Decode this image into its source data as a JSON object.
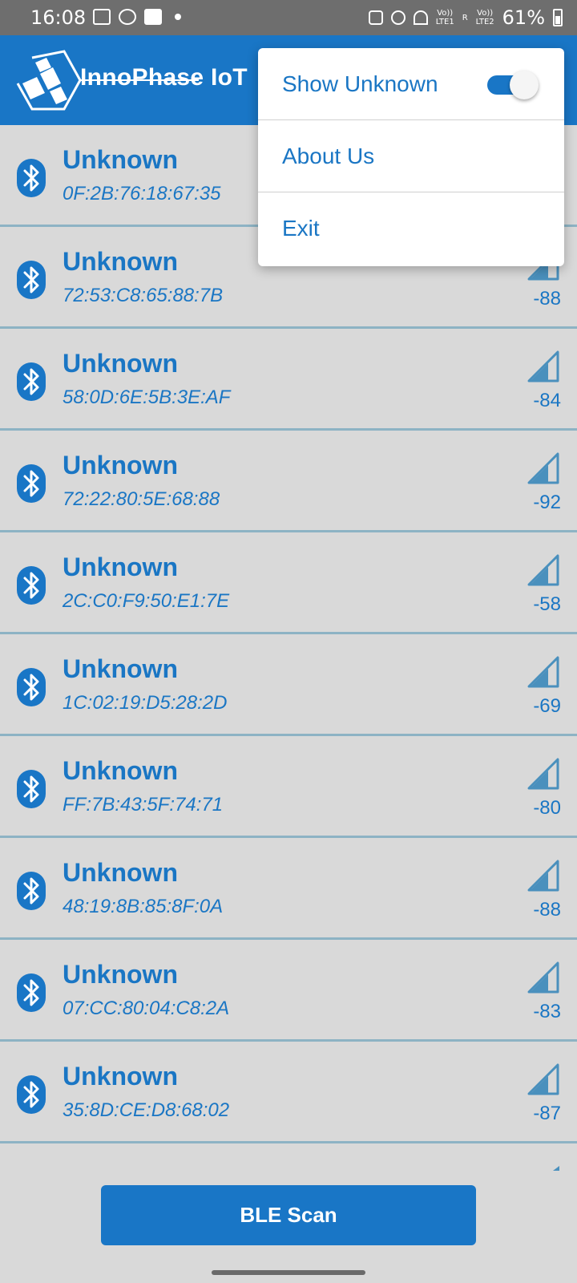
{
  "status_bar": {
    "time": "16:08",
    "net1_top": "Vo))",
    "net1_bottom": "LTE1",
    "roaming": "R",
    "net2_top": "Vo))",
    "net2_bottom": "LTE2",
    "battery": "61%"
  },
  "app_bar": {
    "brand": "InnoPhase IoT"
  },
  "menu": {
    "items": [
      {
        "label": "Show Unknown",
        "toggle_on": true
      },
      {
        "label": "About Us"
      },
      {
        "label": "Exit"
      }
    ]
  },
  "devices": [
    {
      "name": "Unknown",
      "mac": "0F:2B:76:18:67:35",
      "rssi": ""
    },
    {
      "name": "Unknown",
      "mac": "72:53:C8:65:88:7B",
      "rssi": "-88"
    },
    {
      "name": "Unknown",
      "mac": "58:0D:6E:5B:3E:AF",
      "rssi": "-84"
    },
    {
      "name": "Unknown",
      "mac": "72:22:80:5E:68:88",
      "rssi": "-92"
    },
    {
      "name": "Unknown",
      "mac": "2C:C0:F9:50:E1:7E",
      "rssi": "-58"
    },
    {
      "name": "Unknown",
      "mac": "1C:02:19:D5:28:2D",
      "rssi": "-69"
    },
    {
      "name": "Unknown",
      "mac": "FF:7B:43:5F:74:71",
      "rssi": "-80"
    },
    {
      "name": "Unknown",
      "mac": "48:19:8B:85:8F:0A",
      "rssi": "-88"
    },
    {
      "name": "Unknown",
      "mac": "07:CC:80:04:C8:2A",
      "rssi": "-83"
    },
    {
      "name": "Unknown",
      "mac": "35:8D:CE:D8:68:02",
      "rssi": "-87"
    }
  ],
  "scan_button": {
    "label": "BLE Scan"
  },
  "colors": {
    "primary": "#1976c6",
    "text_blue": "#1a76c4",
    "list_bg": "#d9d9d9",
    "divider": "#8db3c4",
    "status_bar": "#6e6e6e"
  },
  "icons": {
    "device": "bluetooth-icon",
    "signal": "signal-strength-icon"
  }
}
